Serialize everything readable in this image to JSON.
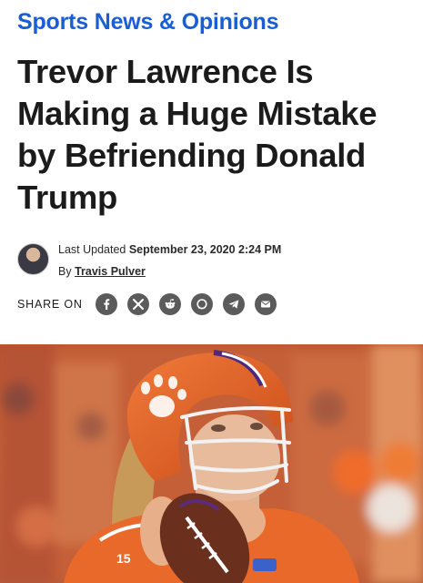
{
  "category": "Sports News & Opinions",
  "headline": "Trevor Lawrence Is Making a Huge Mistake by Befriending Donald Trump",
  "meta": {
    "updated_prefix": "Last Updated",
    "updated_value": "September 23, 2020 2:24 PM",
    "by_prefix": "By",
    "author": "Travis Pulver"
  },
  "share": {
    "label": "SHARE ON",
    "buttons": [
      "facebook-icon",
      "x-icon",
      "reddit-icon",
      "whatsapp-icon",
      "telegram-icon",
      "email-icon"
    ]
  },
  "hero_image": {
    "jersey_number": "15"
  },
  "colors": {
    "category": "#1a5ed6",
    "share_button": "#5b5b5b",
    "helmet_orange": "#e7642a",
    "helmet_purple": "#4b2a7c"
  }
}
